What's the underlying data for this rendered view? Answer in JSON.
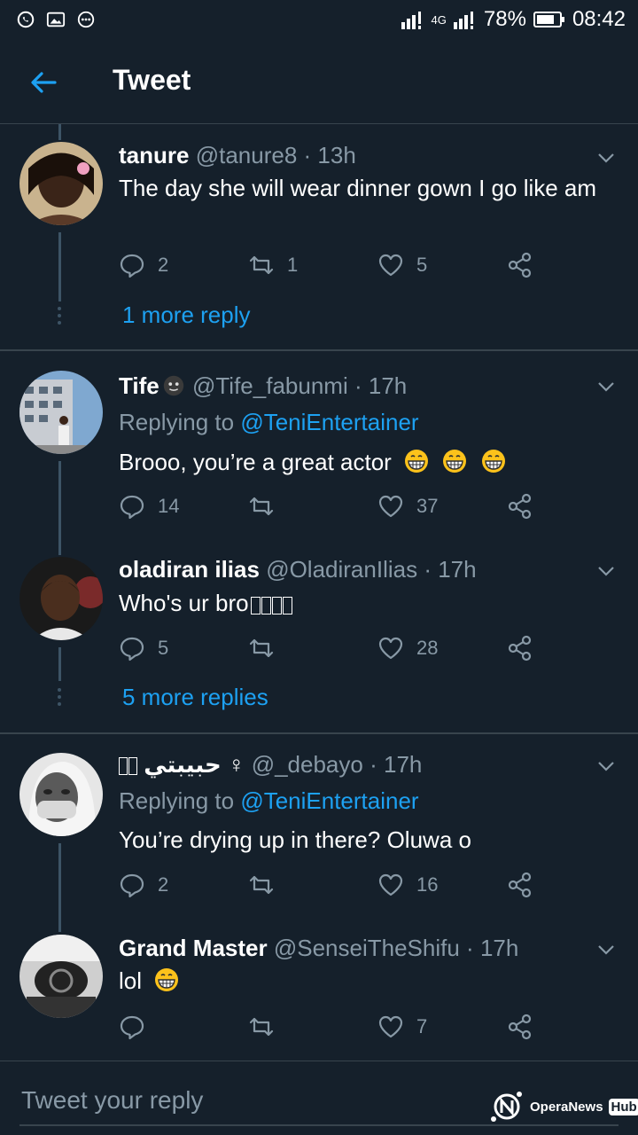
{
  "status_bar": {
    "battery": "78%",
    "time": "08:42",
    "network": "4G"
  },
  "header": {
    "title": "Tweet"
  },
  "tweets": [
    {
      "name": "tanure",
      "handle": "@tanure8",
      "time": "13h",
      "text": "The day she will wear dinner gown I go like am",
      "replies": "2",
      "retweets": "1",
      "likes": "5",
      "more_label": "1 more reply"
    },
    {
      "name": "Tife",
      "handle": "@Tife_fabunmi",
      "time": "17h",
      "replying_prefix": "Replying to",
      "replying_to": "@TeniEntertainer",
      "text": "Brooo, you’re a great actor",
      "replies": "14",
      "retweets": "",
      "likes": "37"
    },
    {
      "name": "oladiran ilias",
      "handle": "@OladiranIlias",
      "time": "17h",
      "text": "Who's ur bro",
      "replies": "5",
      "retweets": "",
      "likes": "28",
      "more_label": "5 more replies"
    },
    {
      "name": "حبيبتي ♀",
      "handle": "@_debayo",
      "time": "17h",
      "replying_prefix": "Replying to",
      "replying_to": "@TeniEntertainer",
      "text": "You’re drying up in there? Oluwa o",
      "replies": "2",
      "retweets": "",
      "likes": "16"
    },
    {
      "name": "Grand Master",
      "handle": "@SenseiTheShifu",
      "time": "17h",
      "text": "lol",
      "replies": "",
      "retweets": "",
      "likes": "7"
    }
  ],
  "reply_bar": {
    "placeholder": "Tweet your reply"
  },
  "watermark": {
    "brand": "OperaNews",
    "badge": "Hub"
  },
  "colors": {
    "background": "#15202b",
    "accent": "#1da1f2",
    "muted": "#8899a6",
    "divider": "#38444d"
  }
}
